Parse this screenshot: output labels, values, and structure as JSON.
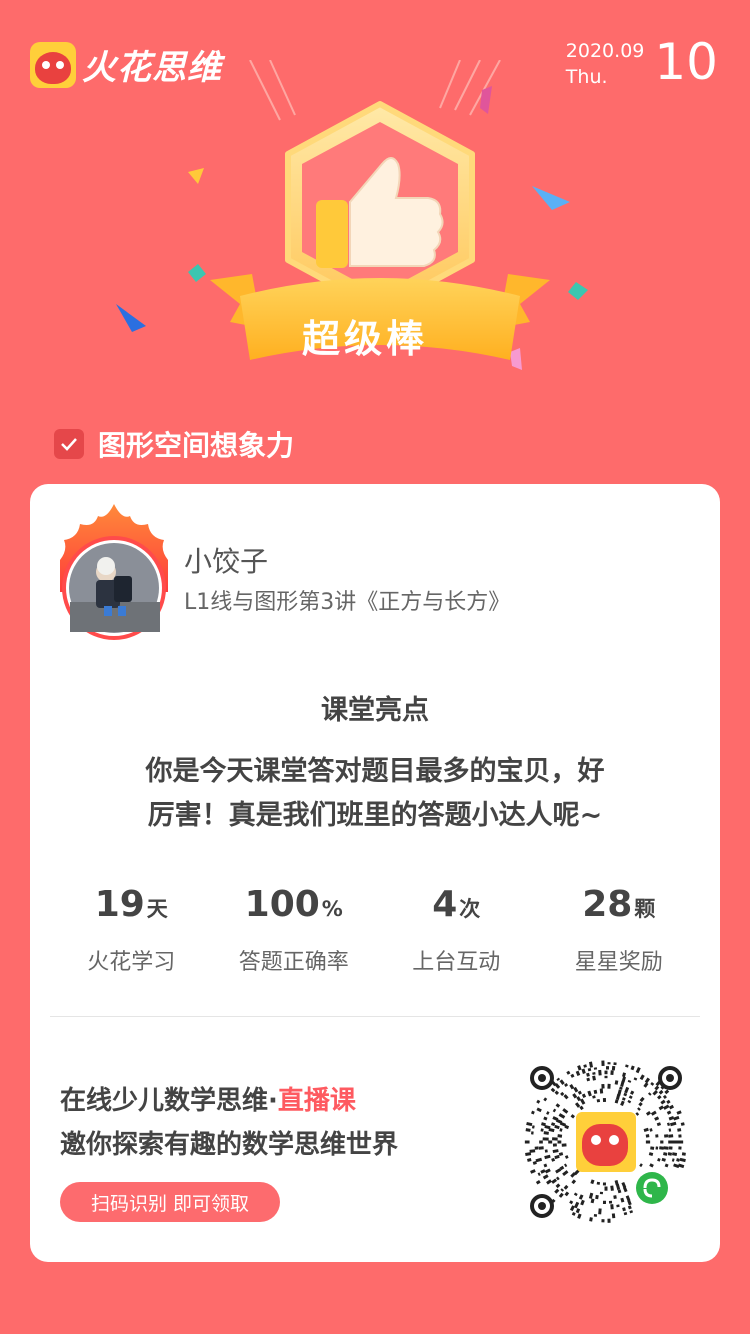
{
  "header": {
    "brand": "火花思维",
    "date_ym": "2020.09",
    "weekday": "Thu.",
    "day": "10"
  },
  "badge": {
    "ribbon_text": "超级棒"
  },
  "category": {
    "label": "图形空间想象力"
  },
  "profile": {
    "name": "小饺子",
    "lesson": "L1线与图形第3讲《正方与长方》"
  },
  "highlight": {
    "title": "课堂亮点",
    "line1": "你是今天课堂答对题目最多的宝贝，好",
    "line2": "厉害！真是我们班里的答题小达人呢~"
  },
  "stats": [
    {
      "value": "19",
      "unit": "天",
      "label": "火花学习"
    },
    {
      "value": "100",
      "unit": "%",
      "label": "答题正确率"
    },
    {
      "value": "4",
      "unit": "次",
      "label": "上台互动"
    },
    {
      "value": "28",
      "unit": "颗",
      "label": "星星奖励"
    }
  ],
  "promo": {
    "line1_prefix": "在线少儿数学思维·",
    "line1_accent": "直播课",
    "line2": "邀你探索有趣的数学思维世界",
    "button": "扫码识别 即可领取"
  },
  "colors": {
    "background": "#fe6b6b",
    "accent": "#fe5a60",
    "badge_gold": "#ffc53a"
  }
}
